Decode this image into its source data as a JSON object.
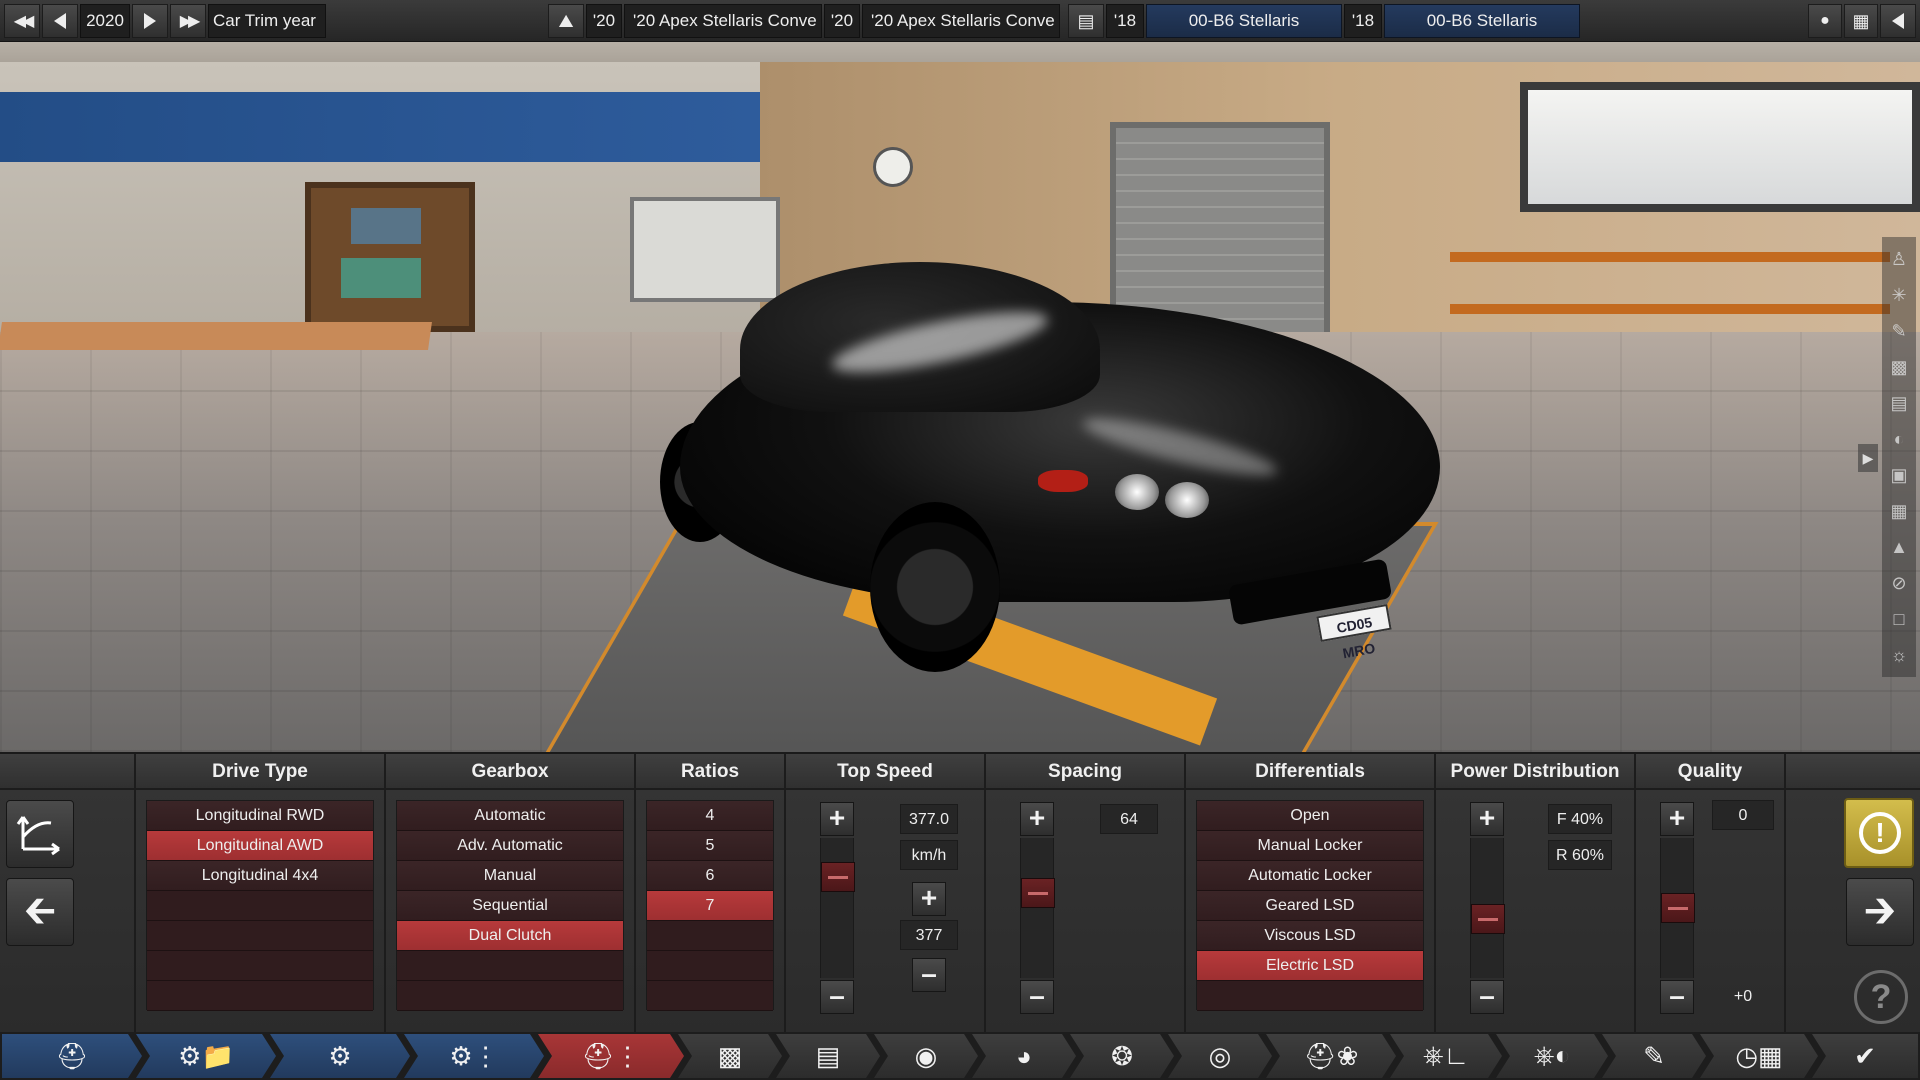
{
  "topbar": {
    "year": "2020",
    "trim_year_label": "Car Trim year",
    "model_a_year": "'20",
    "model_a_name": "'20 Apex Stellaris Conve",
    "model_b_year": "'20",
    "model_b_name": "'20 Apex Stellaris Conve",
    "engine_a_year": "'18",
    "engine_a_name": "00-B6 Stellaris",
    "engine_b_year": "'18",
    "engine_b_name": "00-B6 Stellaris"
  },
  "scene": {
    "license_plate": "CD05 MRO"
  },
  "panel": {
    "drive_type": {
      "header": "Drive Type",
      "items": [
        "Longitudinal RWD",
        "Longitudinal AWD",
        "Longitudinal 4x4",
        "",
        "",
        "",
        ""
      ],
      "selected_index": 1
    },
    "gearbox": {
      "header": "Gearbox",
      "items": [
        "Automatic",
        "Adv. Automatic",
        "Manual",
        "Sequential",
        "Dual Clutch",
        "",
        ""
      ],
      "selected_index": 4
    },
    "ratios": {
      "header": "Ratios",
      "items": [
        "4",
        "5",
        "6",
        "7",
        "",
        "",
        ""
      ],
      "selected_index": 3
    },
    "top_speed": {
      "header": "Top Speed",
      "value": "377.0",
      "unit": "km/h",
      "target": "377",
      "slider_level": 0.78
    },
    "spacing": {
      "header": "Spacing",
      "value": "64",
      "slider_level": 0.64
    },
    "differentials": {
      "header": "Differentials",
      "items": [
        "Open",
        "Manual Locker",
        "Automatic Locker",
        "Geared LSD",
        "Viscous LSD",
        "Electric LSD",
        ""
      ],
      "selected_index": 5
    },
    "power_distribution": {
      "header": "Power Distribution",
      "front": "F 40%",
      "rear": "R 60%",
      "slider_level": 0.4
    },
    "quality": {
      "header": "Quality",
      "value": "0",
      "offset": "+0",
      "slider_level": 0.5
    }
  },
  "colors": {
    "selected_row": "#b73a3b",
    "list_bg": "#311d1f",
    "active_tab": "#a83637",
    "inactive_tab": "#2e4f7c",
    "warning": "#d3bd4c"
  }
}
